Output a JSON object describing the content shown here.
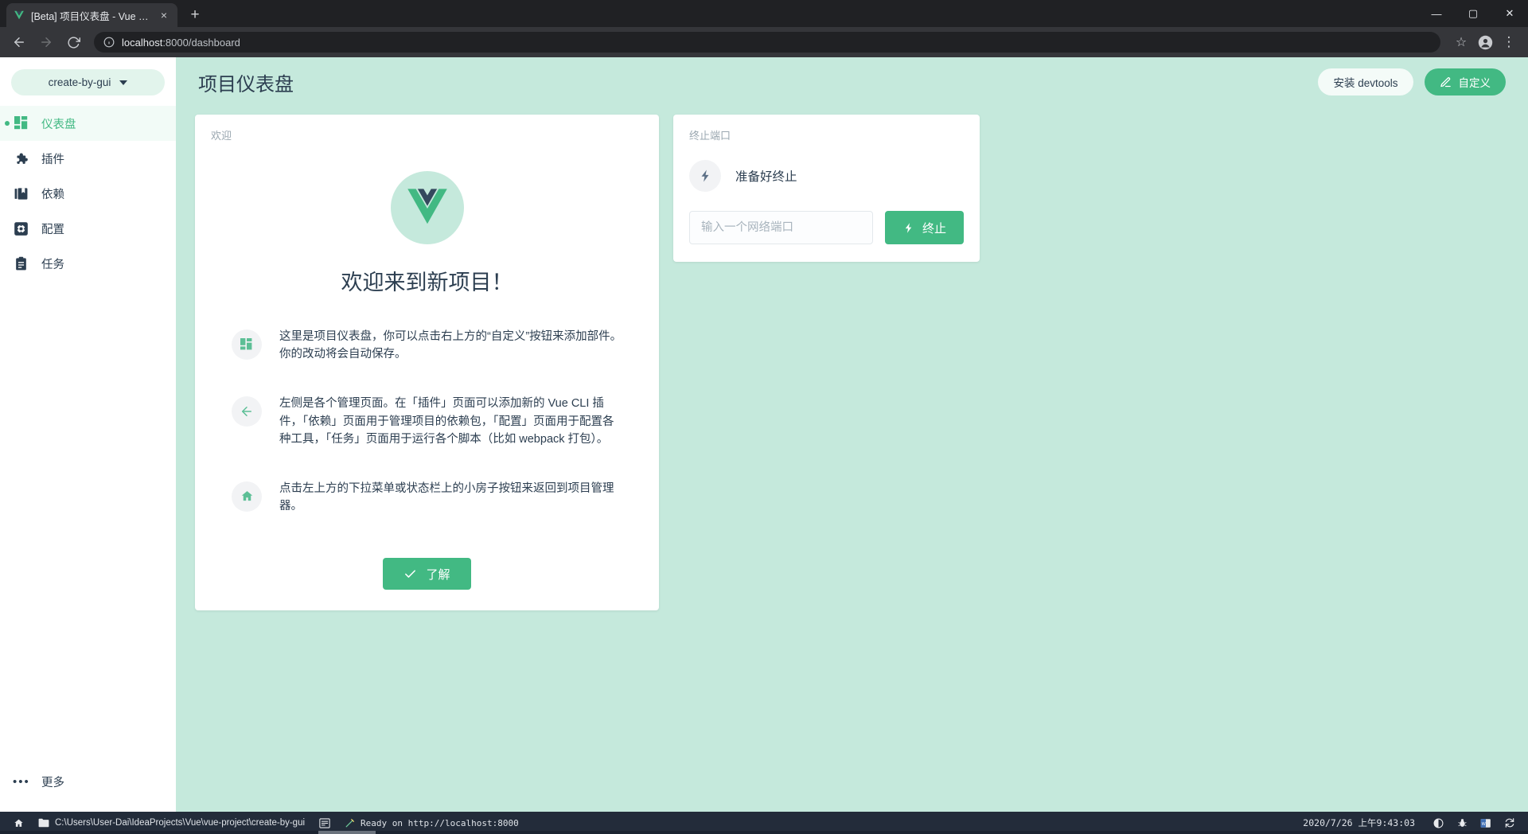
{
  "browser": {
    "tab": {
      "title": "[Beta] 项目仪表盘 - Vue CLI",
      "favicon": "vue-logo-icon",
      "close": "×"
    },
    "new_tab_label": "+",
    "window_controls": {
      "minimize": "—",
      "maximize": "▢",
      "close": "✕"
    },
    "toolbar": {
      "back": "←",
      "forward": "→",
      "reload": "⟳",
      "site_info": "info-icon",
      "url_host": "localhost",
      "url_path": ":8000/dashboard",
      "bookmark": "☆",
      "profile": "profile-icon",
      "menu": "⋮"
    }
  },
  "sidebar": {
    "project_selector": {
      "label": "create-by-gui"
    },
    "items": [
      {
        "label": "仪表盘",
        "icon": "dashboard-icon",
        "active": true
      },
      {
        "label": "插件",
        "icon": "puzzle-icon",
        "active": false
      },
      {
        "label": "依赖",
        "icon": "books-icon",
        "active": false
      },
      {
        "label": "配置",
        "icon": "gear-icon",
        "active": false
      },
      {
        "label": "任务",
        "icon": "clipboard-icon",
        "active": false
      }
    ],
    "more": {
      "label": "更多",
      "icon": "ellipsis-icon"
    }
  },
  "header": {
    "title": "项目仪表盘",
    "install_devtools_label": "安装 devtools",
    "customize_label": "自定义"
  },
  "welcome_card": {
    "card_title": "欢迎",
    "heading": "欢迎来到新项目！",
    "logo": "vue-logo-icon",
    "info": [
      {
        "icon": "dashboard-icon",
        "text": "这里是项目仪表盘，你可以点击右上方的“自定义”按钮来添加部件。你的改动将会自动保存。"
      },
      {
        "icon": "arrow-left-icon",
        "text": "左侧是各个管理页面。在「插件」页面可以添加新的 Vue CLI 插件，「依赖」页面用于管理项目的依赖包，「配置」页面用于配置各种工具，「任务」页面用于运行各个脚本（比如 webpack 打包）。"
      },
      {
        "icon": "home-icon",
        "text": "点击左上方的下拉菜单或状态栏上的小房子按钮来返回到项目管理器。"
      }
    ],
    "ok_button": "了解"
  },
  "port_card": {
    "card_title": "终止端口",
    "status_icon": "lightning-icon",
    "status_text": "准备好终止",
    "input_placeholder": "输入一个网络端口",
    "input_value": "",
    "kill_button": "终止"
  },
  "statusbar": {
    "home_icon": "home-icon",
    "folder_icon": "folder-icon",
    "project_path": "C:\\Users\\User-Dai\\IdeaProjects\\Vue\\vue-project\\create-by-gui",
    "terminal_icon": "terminal-icon",
    "pen_icon": "pen-icon",
    "ready_text": "Ready on http://localhost:8000",
    "time": "2020/7/26 上午9:43:03",
    "tray_icons": [
      "contrast-icon",
      "bug-icon",
      "office-icon",
      "sync-icon"
    ]
  },
  "colors": {
    "accent": "#42b983",
    "page_bg": "#c5e9dc",
    "text": "#2c3e50",
    "muted": "#9aa7b0"
  }
}
